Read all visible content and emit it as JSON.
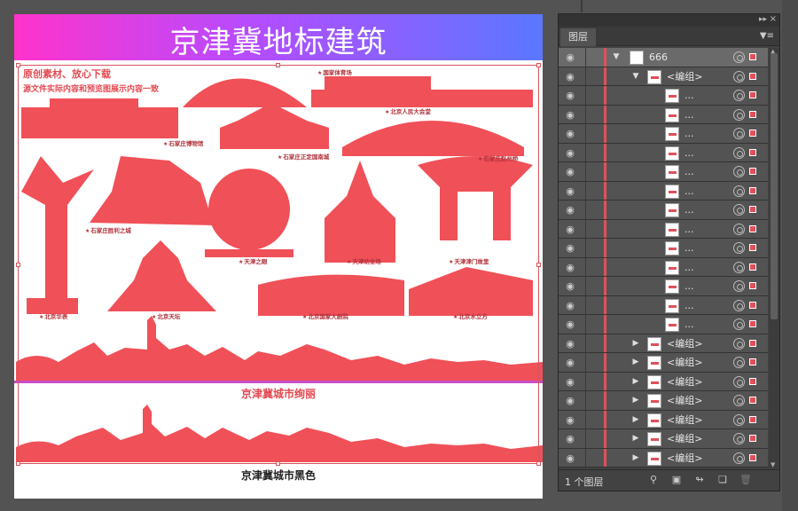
{
  "artboard": {
    "banner_title": "京津冀地标建筑",
    "note_line1": "原创素材、放心下载",
    "note_line2": "源文件实际内容和预览图展示内容一致",
    "landmarks": [
      "国家体育场",
      "北京人民大会堂",
      "石家庄博物馆",
      "石家庄正定国南城",
      "石家庄赵州桥",
      "石家庄胜利之城",
      "天津之眼",
      "天津劝业场",
      "天津津门故里",
      "北京华表",
      "北京天坛",
      "北京国家大剧院",
      "北京水立方"
    ],
    "caption_colorful": "京津冀城市绚丽",
    "caption_black": "京津冀城市黑色",
    "silhouette_color": "#f05058"
  },
  "layers_panel": {
    "tab_label": "图层",
    "layer_name": "666",
    "group_label": "<编组>",
    "path_label": "...",
    "footer_count": "1 个图层",
    "layer_color": "#e0505a",
    "icons": [
      "eye-icon",
      "disclosure-triangle-icon",
      "target-circle-icon",
      "search-icon",
      "clip-mask-icon",
      "sublayer-icon",
      "new-layer-icon",
      "delete-icon",
      "panel-menu-icon",
      "collapse-panel-icon",
      "close-panel-icon"
    ]
  }
}
